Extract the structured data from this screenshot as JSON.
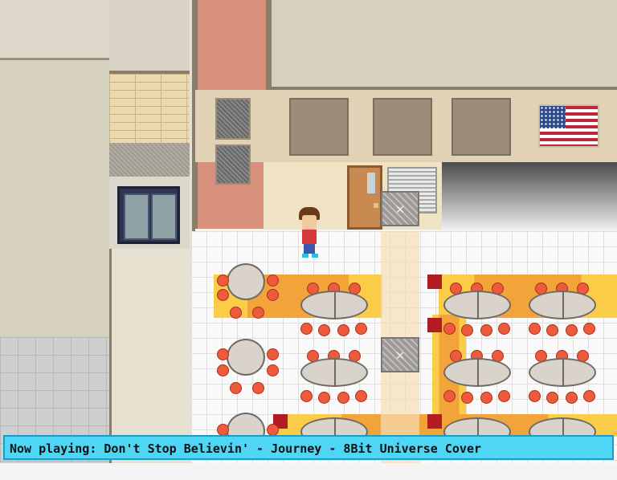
{
  "game": {
    "scene": "school cafeteria",
    "status_bar": {
      "text": "Now playing: Don't Stop Believin' - Journey - 8Bit Universe Cover",
      "color": "#4fd6f5"
    },
    "markers": [
      {
        "icon": "x-marker-icon",
        "glyph": "✕"
      },
      {
        "icon": "x-marker-icon",
        "glyph": "✕"
      }
    ],
    "colors": {
      "floor": "#fafafa",
      "rug": "#f2a43a",
      "rug_accent": "#b01c22",
      "stool": "#ee5a3c"
    }
  }
}
